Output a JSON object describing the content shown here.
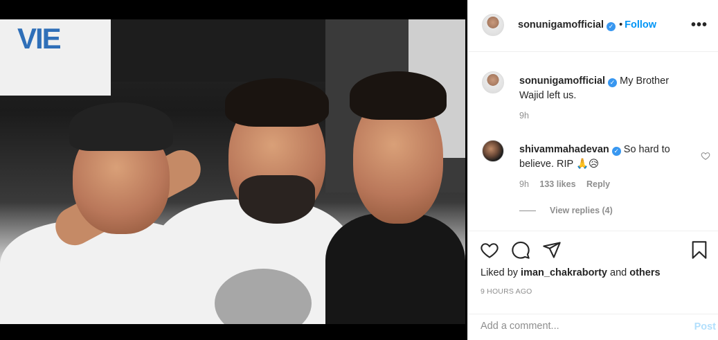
{
  "photo": {
    "sign_text": "VIE"
  },
  "header": {
    "username": "sonunigamofficial",
    "separator": "•",
    "follow_label": "Follow",
    "more_label": "•••"
  },
  "caption": {
    "username": "sonunigamofficial",
    "text": "My Brother Wajid left us.",
    "time": "9h"
  },
  "comments": [
    {
      "username": "shivammahadevan",
      "text": "So hard to believe. RIP 🙏😥",
      "time": "9h",
      "likes": "133 likes",
      "reply_label": "Reply",
      "view_replies": "View replies (4)"
    }
  ],
  "likes": {
    "prefix": "Liked by",
    "user": "iman_chakraborty",
    "conjunction": "and",
    "others": "others"
  },
  "timestamp": "9 HOURS AGO",
  "composer": {
    "placeholder": "Add a comment...",
    "post_label": "Post"
  },
  "colors": {
    "accent": "#0095f6",
    "verified": "#3897f0",
    "post_disabled": "#b2dffc",
    "muted": "#8e8e8e"
  },
  "icons": [
    "heart-icon",
    "comment-icon",
    "share-icon",
    "bookmark-icon",
    "more-options-icon",
    "verified-badge-icon",
    "small-heart-icon"
  ]
}
